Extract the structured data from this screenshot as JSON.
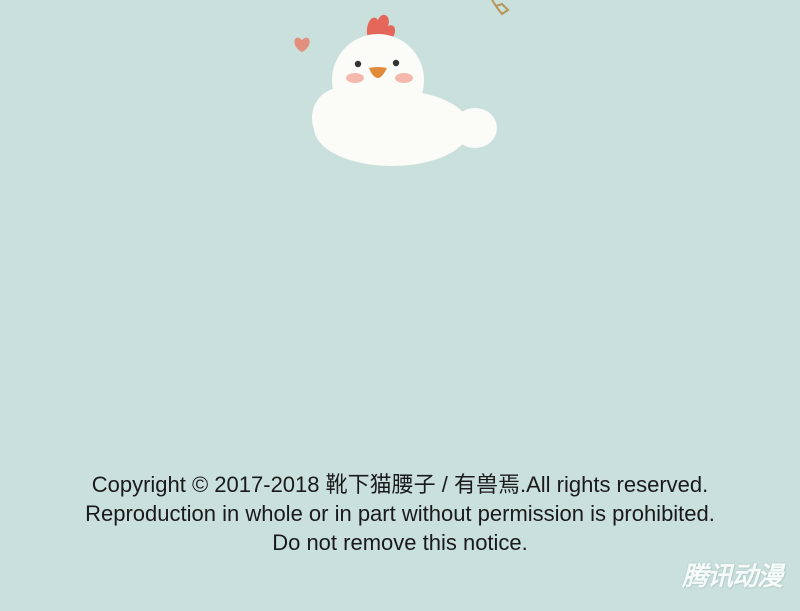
{
  "notice": {
    "line1": "Copyright © 2017-2018 靴下猫腰子 / 有兽焉.All rights reserved.",
    "line2": "Reproduction in whole or in part without permission is prohibited.",
    "line3": "Do not remove this notice."
  },
  "watermark": {
    "text": "腾讯动漫"
  },
  "colors": {
    "background": "#c9e0dc",
    "text": "#1a1a1a"
  }
}
